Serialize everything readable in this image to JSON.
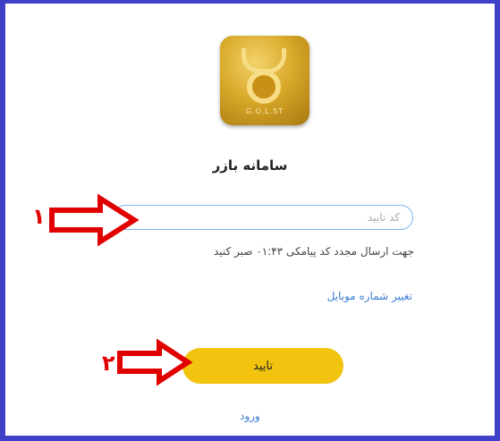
{
  "app": {
    "logo_text": "G.O.L.ST",
    "title": "سامانه بازر"
  },
  "form": {
    "code_placeholder": "کد تایید",
    "resend_text": "جهت ارسال مجدد کد پیامکی ۰۱:۴۳ صبر کنید",
    "change_mobile_label": "تغییر شماره موبایل",
    "confirm_label": "تایید",
    "login_label": "ورود"
  },
  "annotations": {
    "step1_label": "۱",
    "step2_label": "۲",
    "arrow_color": "#e10000"
  },
  "colors": {
    "frame": "#3e41c7",
    "button": "#f2c30f",
    "link": "#3a7dd1"
  }
}
